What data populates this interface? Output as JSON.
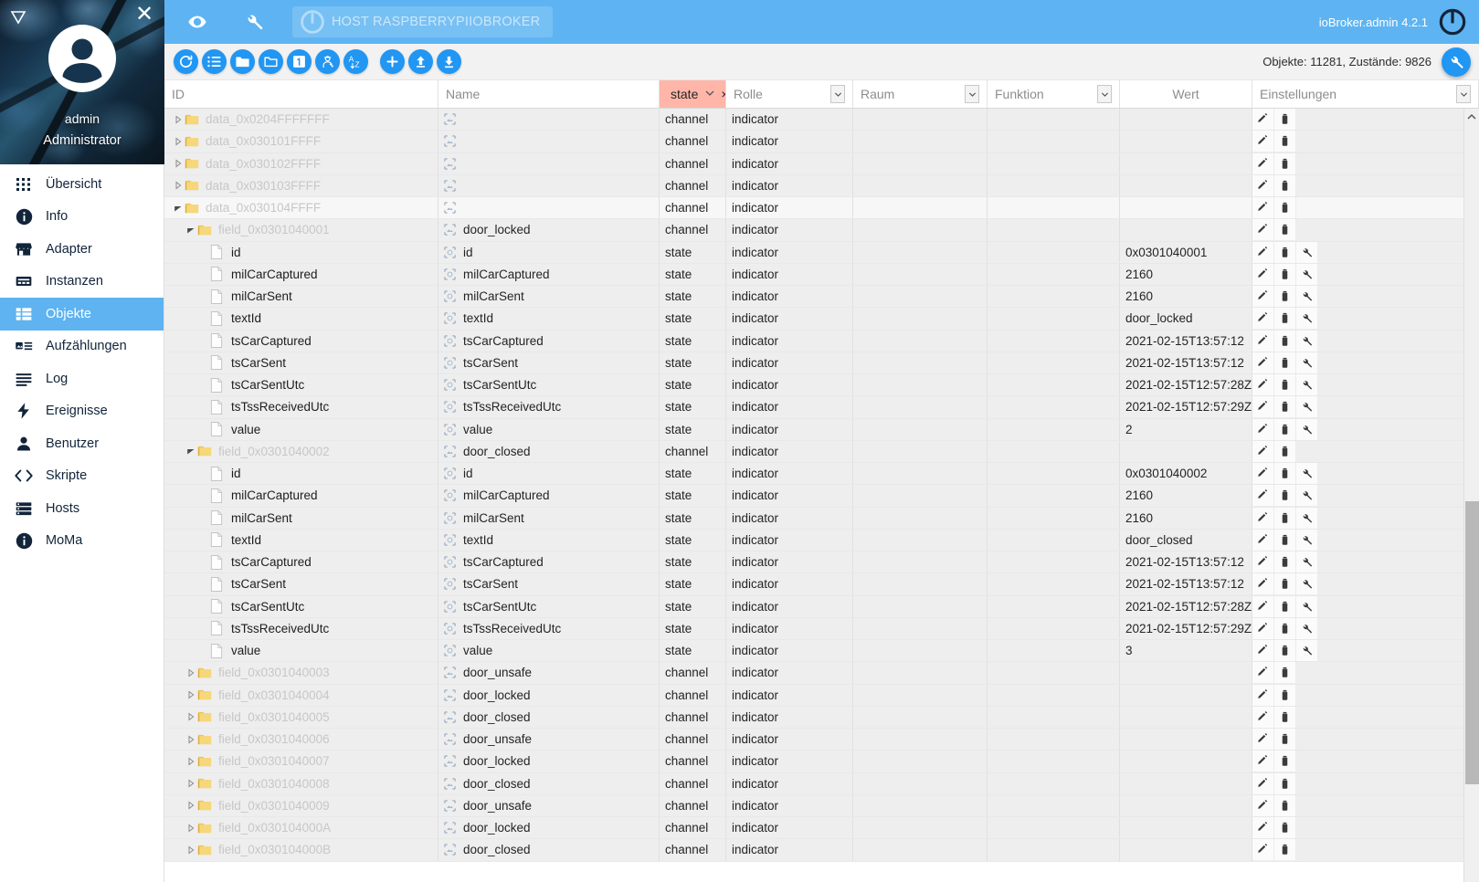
{
  "sidebar": {
    "collapse_icon": "collapse-triangle-icon",
    "close_icon": "close-icon",
    "user_name": "admin",
    "user_role": "Administrator",
    "items": [
      {
        "label": "Übersicht",
        "icon": "grid-icon",
        "active": false
      },
      {
        "label": "Info",
        "icon": "info-icon",
        "active": false
      },
      {
        "label": "Adapter",
        "icon": "store-icon",
        "active": false
      },
      {
        "label": "Instanzen",
        "icon": "instances-icon",
        "active": false
      },
      {
        "label": "Objekte",
        "icon": "objects-list-icon",
        "active": true
      },
      {
        "label": "Aufzählungen",
        "icon": "enums-icon",
        "active": false
      },
      {
        "label": "Log",
        "icon": "log-lines-icon",
        "active": false
      },
      {
        "label": "Ereignisse",
        "icon": "bolt-icon",
        "active": false
      },
      {
        "label": "Benutzer",
        "icon": "person-icon",
        "active": false
      },
      {
        "label": "Skripte",
        "icon": "code-brackets-icon",
        "active": false
      },
      {
        "label": "Hosts",
        "icon": "server-icon",
        "active": false
      },
      {
        "label": "MoMa",
        "icon": "info-icon",
        "active": false
      }
    ]
  },
  "appbar": {
    "eye_icon": "eye-icon",
    "wrench_icon": "wrench-icon",
    "host_label": "HOST RASPBERRYPIIOBROKER",
    "host_icon": "iobroker-logo-icon",
    "version": "ioBroker.admin 4.2.1",
    "logo_icon": "iobroker-logo-icon"
  },
  "toolbar": {
    "buttons": [
      {
        "name": "refresh-button",
        "icon": "refresh-icon"
      },
      {
        "name": "expand-all-button",
        "icon": "list-expand-icon"
      },
      {
        "name": "collapse-folder-button",
        "icon": "folder-filled-icon"
      },
      {
        "name": "expand-folder-button",
        "icon": "folder-outline-icon"
      },
      {
        "name": "depth-one-button",
        "icon": "number-one-box-icon"
      },
      {
        "name": "expert-mode-button",
        "icon": "expert-hat-icon"
      },
      {
        "name": "sort-alpha-button",
        "icon": "sort-az-icon"
      },
      {
        "name": "add-object-button",
        "icon": "plus-icon"
      },
      {
        "name": "upload-button",
        "icon": "upload-arrow-icon"
      },
      {
        "name": "download-button",
        "icon": "download-arrow-icon"
      }
    ],
    "stats": "Objekte: 11281, Zustände: 9826",
    "settings_icon": "wrench-icon"
  },
  "table": {
    "columns": [
      {
        "key": "id",
        "label": "ID",
        "filter": true,
        "type": "text"
      },
      {
        "key": "name",
        "label": "Name",
        "filter": true,
        "type": "text"
      },
      {
        "key": "type",
        "label": "state",
        "filter": true,
        "type": "chip",
        "highlight": "#ffb6a8"
      },
      {
        "key": "role",
        "label": "Rolle",
        "filter": true,
        "type": "select"
      },
      {
        "key": "room",
        "label": "Raum",
        "filter": true,
        "type": "select"
      },
      {
        "key": "function",
        "label": "Funktion",
        "filter": true,
        "type": "select"
      },
      {
        "key": "value",
        "label": "Wert",
        "filter": false,
        "type": "plain"
      },
      {
        "key": "settings",
        "label": "Einstellungen",
        "filter": true,
        "type": "select"
      }
    ],
    "type_filter_clear": "×",
    "rows": [
      {
        "indent": 1,
        "twisty": "collapsed",
        "icon": "folder-icon",
        "id": "data_0x0204FFFFFFF",
        "name": "",
        "type": "channel",
        "role": "indicator",
        "room": "",
        "function": "",
        "value": "",
        "actions": [
          "edit-icon",
          "delete-icon"
        ]
      },
      {
        "indent": 1,
        "twisty": "collapsed",
        "icon": "folder-icon",
        "id": "data_0x030101FFFF",
        "name": "",
        "type": "channel",
        "role": "indicator",
        "room": "",
        "function": "",
        "value": "",
        "actions": [
          "edit-icon",
          "delete-icon"
        ]
      },
      {
        "indent": 1,
        "twisty": "collapsed",
        "icon": "folder-icon",
        "id": "data_0x030102FFFF",
        "name": "",
        "type": "channel",
        "role": "indicator",
        "room": "",
        "function": "",
        "value": "",
        "actions": [
          "edit-icon",
          "delete-icon"
        ]
      },
      {
        "indent": 1,
        "twisty": "collapsed",
        "icon": "folder-icon",
        "id": "data_0x030103FFFF",
        "name": "",
        "type": "channel",
        "role": "indicator",
        "room": "",
        "function": "",
        "value": "",
        "actions": [
          "edit-icon",
          "delete-icon"
        ]
      },
      {
        "indent": 1,
        "twisty": "expanded",
        "icon": "folder-icon",
        "id": "data_0x030104FFFF",
        "name": "",
        "type": "channel",
        "role": "indicator",
        "room": "",
        "function": "",
        "value": "",
        "actions": [
          "edit-icon",
          "delete-icon"
        ],
        "selected": true
      },
      {
        "indent": 2,
        "twisty": "expanded",
        "icon": "folder-icon",
        "id": "field_0x0301040001",
        "name": "door_locked",
        "type": "channel",
        "role": "indicator",
        "room": "",
        "function": "",
        "value": "",
        "actions": [
          "edit-icon",
          "delete-icon"
        ]
      },
      {
        "indent": 3,
        "twisty": "none",
        "icon": "document-icon",
        "id": "id",
        "name": "id",
        "type": "state",
        "role": "indicator",
        "room": "",
        "function": "",
        "value": "0x0301040001",
        "actions": [
          "edit-icon",
          "delete-icon",
          "wrench-icon"
        ],
        "dark": true
      },
      {
        "indent": 3,
        "twisty": "none",
        "icon": "document-icon",
        "id": "milCarCaptured",
        "name": "milCarCaptured",
        "type": "state",
        "role": "indicator",
        "room": "",
        "function": "",
        "value": "2160",
        "actions": [
          "edit-icon",
          "delete-icon",
          "wrench-icon"
        ],
        "dark": true
      },
      {
        "indent": 3,
        "twisty": "none",
        "icon": "document-icon",
        "id": "milCarSent",
        "name": "milCarSent",
        "type": "state",
        "role": "indicator",
        "room": "",
        "function": "",
        "value": "2160",
        "actions": [
          "edit-icon",
          "delete-icon",
          "wrench-icon"
        ],
        "dark": true
      },
      {
        "indent": 3,
        "twisty": "none",
        "icon": "document-icon",
        "id": "textId",
        "name": "textId",
        "type": "state",
        "role": "indicator",
        "room": "",
        "function": "",
        "value": "door_locked",
        "actions": [
          "edit-icon",
          "delete-icon",
          "wrench-icon"
        ],
        "dark": true
      },
      {
        "indent": 3,
        "twisty": "none",
        "icon": "document-icon",
        "id": "tsCarCaptured",
        "name": "tsCarCaptured",
        "type": "state",
        "role": "indicator",
        "room": "",
        "function": "",
        "value": "2021-02-15T13:57:12",
        "actions": [
          "edit-icon",
          "delete-icon",
          "wrench-icon"
        ],
        "dark": true
      },
      {
        "indent": 3,
        "twisty": "none",
        "icon": "document-icon",
        "id": "tsCarSent",
        "name": "tsCarSent",
        "type": "state",
        "role": "indicator",
        "room": "",
        "function": "",
        "value": "2021-02-15T13:57:12",
        "actions": [
          "edit-icon",
          "delete-icon",
          "wrench-icon"
        ],
        "dark": true
      },
      {
        "indent": 3,
        "twisty": "none",
        "icon": "document-icon",
        "id": "tsCarSentUtc",
        "name": "tsCarSentUtc",
        "type": "state",
        "role": "indicator",
        "room": "",
        "function": "",
        "value": "2021-02-15T12:57:28Z",
        "actions": [
          "edit-icon",
          "delete-icon",
          "wrench-icon"
        ],
        "dark": true
      },
      {
        "indent": 3,
        "twisty": "none",
        "icon": "document-icon",
        "id": "tsTssReceivedUtc",
        "name": "tsTssReceivedUtc",
        "type": "state",
        "role": "indicator",
        "room": "",
        "function": "",
        "value": "2021-02-15T12:57:29Z",
        "actions": [
          "edit-icon",
          "delete-icon",
          "wrench-icon"
        ],
        "dark": true
      },
      {
        "indent": 3,
        "twisty": "none",
        "icon": "document-icon",
        "id": "value",
        "name": "value",
        "type": "state",
        "role": "indicator",
        "room": "",
        "function": "",
        "value": "2",
        "actions": [
          "edit-icon",
          "delete-icon",
          "wrench-icon"
        ],
        "dark": true
      },
      {
        "indent": 2,
        "twisty": "expanded",
        "icon": "folder-icon",
        "id": "field_0x0301040002",
        "name": "door_closed",
        "type": "channel",
        "role": "indicator",
        "room": "",
        "function": "",
        "value": "",
        "actions": [
          "edit-icon",
          "delete-icon"
        ]
      },
      {
        "indent": 3,
        "twisty": "none",
        "icon": "document-icon",
        "id": "id",
        "name": "id",
        "type": "state",
        "role": "indicator",
        "room": "",
        "function": "",
        "value": "0x0301040002",
        "actions": [
          "edit-icon",
          "delete-icon",
          "wrench-icon"
        ],
        "dark": true
      },
      {
        "indent": 3,
        "twisty": "none",
        "icon": "document-icon",
        "id": "milCarCaptured",
        "name": "milCarCaptured",
        "type": "state",
        "role": "indicator",
        "room": "",
        "function": "",
        "value": "2160",
        "actions": [
          "edit-icon",
          "delete-icon",
          "wrench-icon"
        ],
        "dark": true
      },
      {
        "indent": 3,
        "twisty": "none",
        "icon": "document-icon",
        "id": "milCarSent",
        "name": "milCarSent",
        "type": "state",
        "role": "indicator",
        "room": "",
        "function": "",
        "value": "2160",
        "actions": [
          "edit-icon",
          "delete-icon",
          "wrench-icon"
        ],
        "dark": true
      },
      {
        "indent": 3,
        "twisty": "none",
        "icon": "document-icon",
        "id": "textId",
        "name": "textId",
        "type": "state",
        "role": "indicator",
        "room": "",
        "function": "",
        "value": "door_closed",
        "actions": [
          "edit-icon",
          "delete-icon",
          "wrench-icon"
        ],
        "dark": true
      },
      {
        "indent": 3,
        "twisty": "none",
        "icon": "document-icon",
        "id": "tsCarCaptured",
        "name": "tsCarCaptured",
        "type": "state",
        "role": "indicator",
        "room": "",
        "function": "",
        "value": "2021-02-15T13:57:12",
        "actions": [
          "edit-icon",
          "delete-icon",
          "wrench-icon"
        ],
        "dark": true
      },
      {
        "indent": 3,
        "twisty": "none",
        "icon": "document-icon",
        "id": "tsCarSent",
        "name": "tsCarSent",
        "type": "state",
        "role": "indicator",
        "room": "",
        "function": "",
        "value": "2021-02-15T13:57:12",
        "actions": [
          "edit-icon",
          "delete-icon",
          "wrench-icon"
        ],
        "dark": true
      },
      {
        "indent": 3,
        "twisty": "none",
        "icon": "document-icon",
        "id": "tsCarSentUtc",
        "name": "tsCarSentUtc",
        "type": "state",
        "role": "indicator",
        "room": "",
        "function": "",
        "value": "2021-02-15T12:57:28Z",
        "actions": [
          "edit-icon",
          "delete-icon",
          "wrench-icon"
        ],
        "dark": true
      },
      {
        "indent": 3,
        "twisty": "none",
        "icon": "document-icon",
        "id": "tsTssReceivedUtc",
        "name": "tsTssReceivedUtc",
        "type": "state",
        "role": "indicator",
        "room": "",
        "function": "",
        "value": "2021-02-15T12:57:29Z",
        "actions": [
          "edit-icon",
          "delete-icon",
          "wrench-icon"
        ],
        "dark": true
      },
      {
        "indent": 3,
        "twisty": "none",
        "icon": "document-icon",
        "id": "value",
        "name": "value",
        "type": "state",
        "role": "indicator",
        "room": "",
        "function": "",
        "value": "3",
        "actions": [
          "edit-icon",
          "delete-icon",
          "wrench-icon"
        ],
        "dark": true
      },
      {
        "indent": 2,
        "twisty": "collapsed",
        "icon": "folder-icon",
        "id": "field_0x0301040003",
        "name": "door_unsafe",
        "type": "channel",
        "role": "indicator",
        "room": "",
        "function": "",
        "value": "",
        "actions": [
          "edit-icon",
          "delete-icon"
        ]
      },
      {
        "indent": 2,
        "twisty": "collapsed",
        "icon": "folder-icon",
        "id": "field_0x0301040004",
        "name": "door_locked",
        "type": "channel",
        "role": "indicator",
        "room": "",
        "function": "",
        "value": "",
        "actions": [
          "edit-icon",
          "delete-icon"
        ]
      },
      {
        "indent": 2,
        "twisty": "collapsed",
        "icon": "folder-icon",
        "id": "field_0x0301040005",
        "name": "door_closed",
        "type": "channel",
        "role": "indicator",
        "room": "",
        "function": "",
        "value": "",
        "actions": [
          "edit-icon",
          "delete-icon"
        ]
      },
      {
        "indent": 2,
        "twisty": "collapsed",
        "icon": "folder-icon",
        "id": "field_0x0301040006",
        "name": "door_unsafe",
        "type": "channel",
        "role": "indicator",
        "room": "",
        "function": "",
        "value": "",
        "actions": [
          "edit-icon",
          "delete-icon"
        ]
      },
      {
        "indent": 2,
        "twisty": "collapsed",
        "icon": "folder-icon",
        "id": "field_0x0301040007",
        "name": "door_locked",
        "type": "channel",
        "role": "indicator",
        "room": "",
        "function": "",
        "value": "",
        "actions": [
          "edit-icon",
          "delete-icon"
        ]
      },
      {
        "indent": 2,
        "twisty": "collapsed",
        "icon": "folder-icon",
        "id": "field_0x0301040008",
        "name": "door_closed",
        "type": "channel",
        "role": "indicator",
        "room": "",
        "function": "",
        "value": "",
        "actions": [
          "edit-icon",
          "delete-icon"
        ]
      },
      {
        "indent": 2,
        "twisty": "collapsed",
        "icon": "folder-icon",
        "id": "field_0x0301040009",
        "name": "door_unsafe",
        "type": "channel",
        "role": "indicator",
        "room": "",
        "function": "",
        "value": "",
        "actions": [
          "edit-icon",
          "delete-icon"
        ]
      },
      {
        "indent": 2,
        "twisty": "collapsed",
        "icon": "folder-icon",
        "id": "field_0x030104000A",
        "name": "door_locked",
        "type": "channel",
        "role": "indicator",
        "room": "",
        "function": "",
        "value": "",
        "actions": [
          "edit-icon",
          "delete-icon"
        ]
      },
      {
        "indent": 2,
        "twisty": "collapsed",
        "icon": "folder-icon",
        "id": "field_0x030104000B",
        "name": "door_closed",
        "type": "channel",
        "role": "indicator",
        "room": "",
        "function": "",
        "value": "",
        "actions": [
          "edit-icon",
          "delete-icon"
        ]
      }
    ]
  },
  "colors": {
    "accent": "#5eb4f2",
    "toolbar_button": "#2196f3",
    "filter_highlight": "#ffb6a8",
    "sidebar_active": "#5eb3f0"
  }
}
